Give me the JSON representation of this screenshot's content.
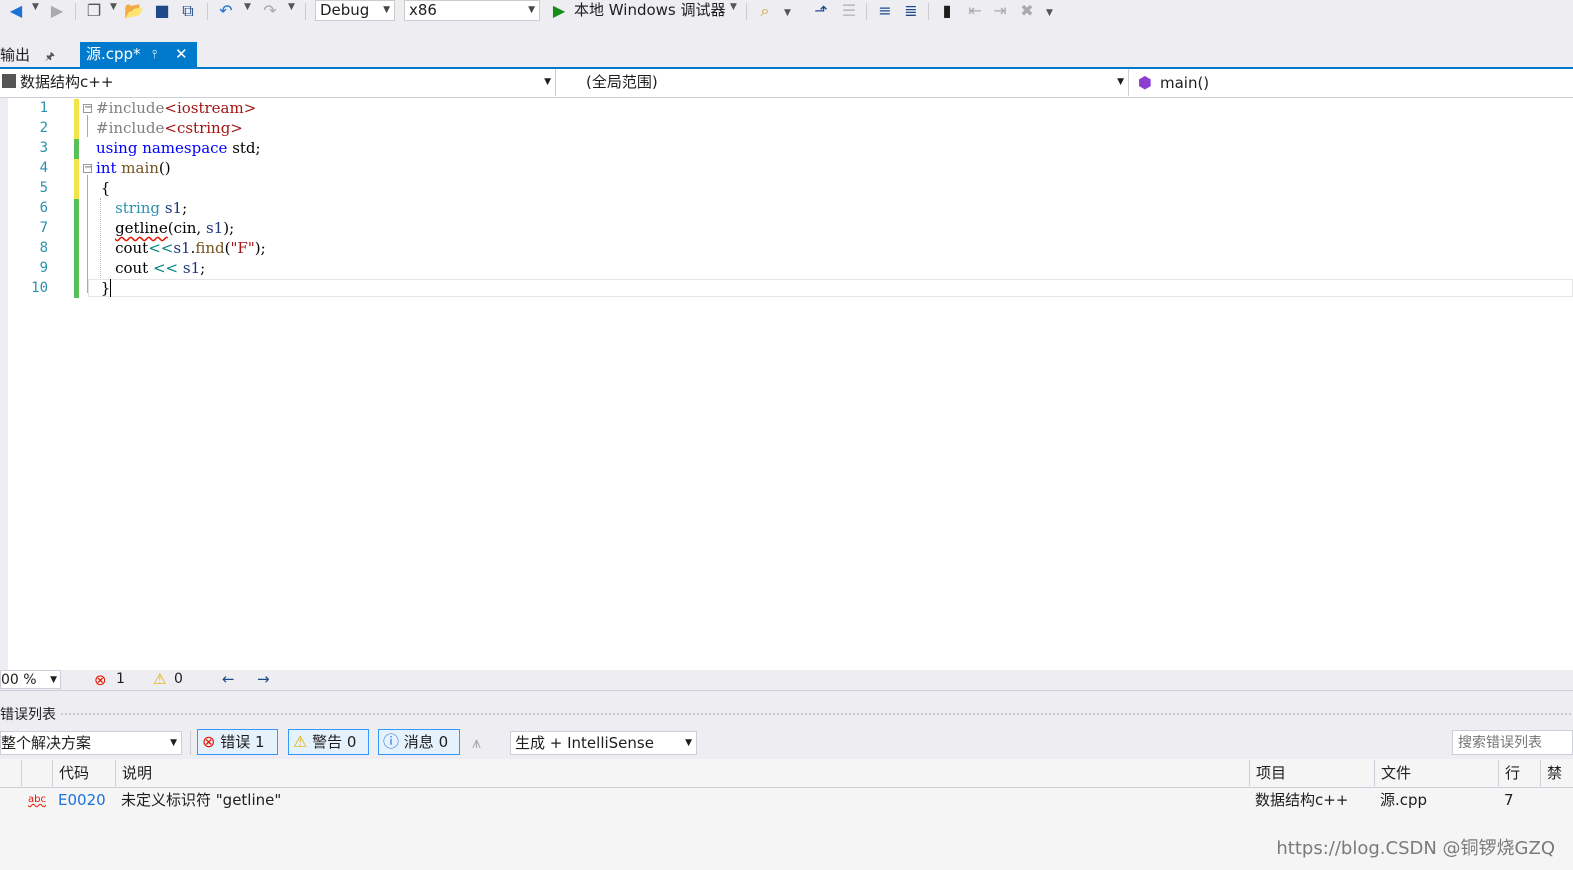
{
  "toolbar": {
    "config": "Debug",
    "platform": "x86",
    "run_label": "本地 Windows 调试器"
  },
  "tabs": {
    "output_label": "输出",
    "active_file": "源.cpp*"
  },
  "navbar": {
    "project": "数据结构c++",
    "scope": "(全局范围)",
    "member": "main()"
  },
  "editor": {
    "line_numbers": [
      "1",
      "2",
      "3",
      "4",
      "5",
      "6",
      "7",
      "8",
      "9",
      "10"
    ]
  },
  "editor_status": {
    "zoom": "00 %",
    "errors": "1",
    "warnings": "0"
  },
  "error_list": {
    "title": "错误列表",
    "scope": "整个解决方案",
    "errors_btn": "错误 1",
    "warnings_btn": "警告 0",
    "messages_btn": "消息 0",
    "source_filter": "生成 + IntelliSense",
    "search_placeholder": "搜索错误列表",
    "columns": [
      "代码",
      "说明",
      "项目",
      "文件",
      "行",
      "禁止"
    ],
    "rows": [
      {
        "code": "E0020",
        "description": "未定义标识符 \"getline\"",
        "project": "数据结构c++",
        "file": "源.cpp",
        "line": "7"
      }
    ]
  },
  "watermark": "https://blog.CSDN @铜锣烧GZQ",
  "colors": {
    "accent": "#007acc",
    "error": "#e51400",
    "warning": "#f2c300",
    "info": "#1c71d8"
  }
}
